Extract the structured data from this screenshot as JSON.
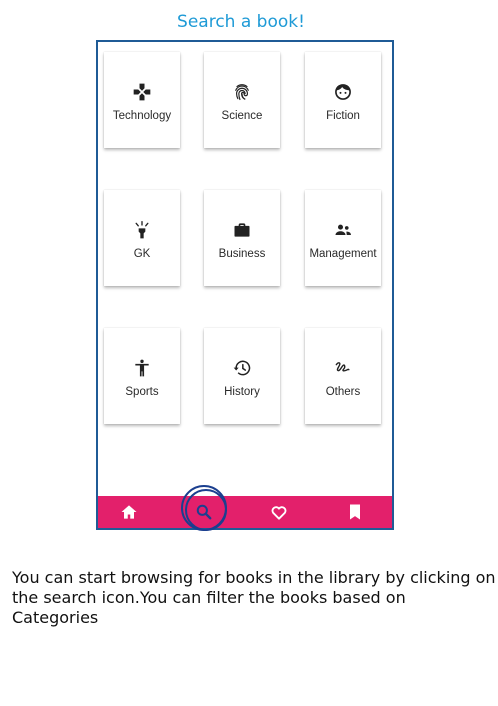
{
  "header": {
    "title": "Search a book!"
  },
  "categories": [
    {
      "label": "Technology",
      "icon": "gamepad-icon"
    },
    {
      "label": "Science",
      "icon": "fingerprint-icon"
    },
    {
      "label": "Fiction",
      "icon": "face-icon"
    },
    {
      "label": "GK",
      "icon": "lightbulb-icon"
    },
    {
      "label": "Business",
      "icon": "briefcase-icon"
    },
    {
      "label": "Management",
      "icon": "people-icon"
    },
    {
      "label": "Sports",
      "icon": "accessibility-icon"
    },
    {
      "label": "History",
      "icon": "history-icon"
    },
    {
      "label": "Others",
      "icon": "gesture-icon"
    }
  ],
  "bottom_nav": {
    "items": [
      {
        "icon": "home-icon"
      },
      {
        "icon": "search-icon"
      },
      {
        "icon": "heart-icon"
      },
      {
        "icon": "bookmark-icon"
      }
    ],
    "color": "#e3206b"
  },
  "caption": "You can start browsing for books in the library by clicking on the search icon.You can filter the books based on Categories",
  "colors": {
    "title": "#1e9ad6",
    "frame": "#1f5b96",
    "nav": "#e3206b",
    "highlight": "#1b3f8f"
  }
}
